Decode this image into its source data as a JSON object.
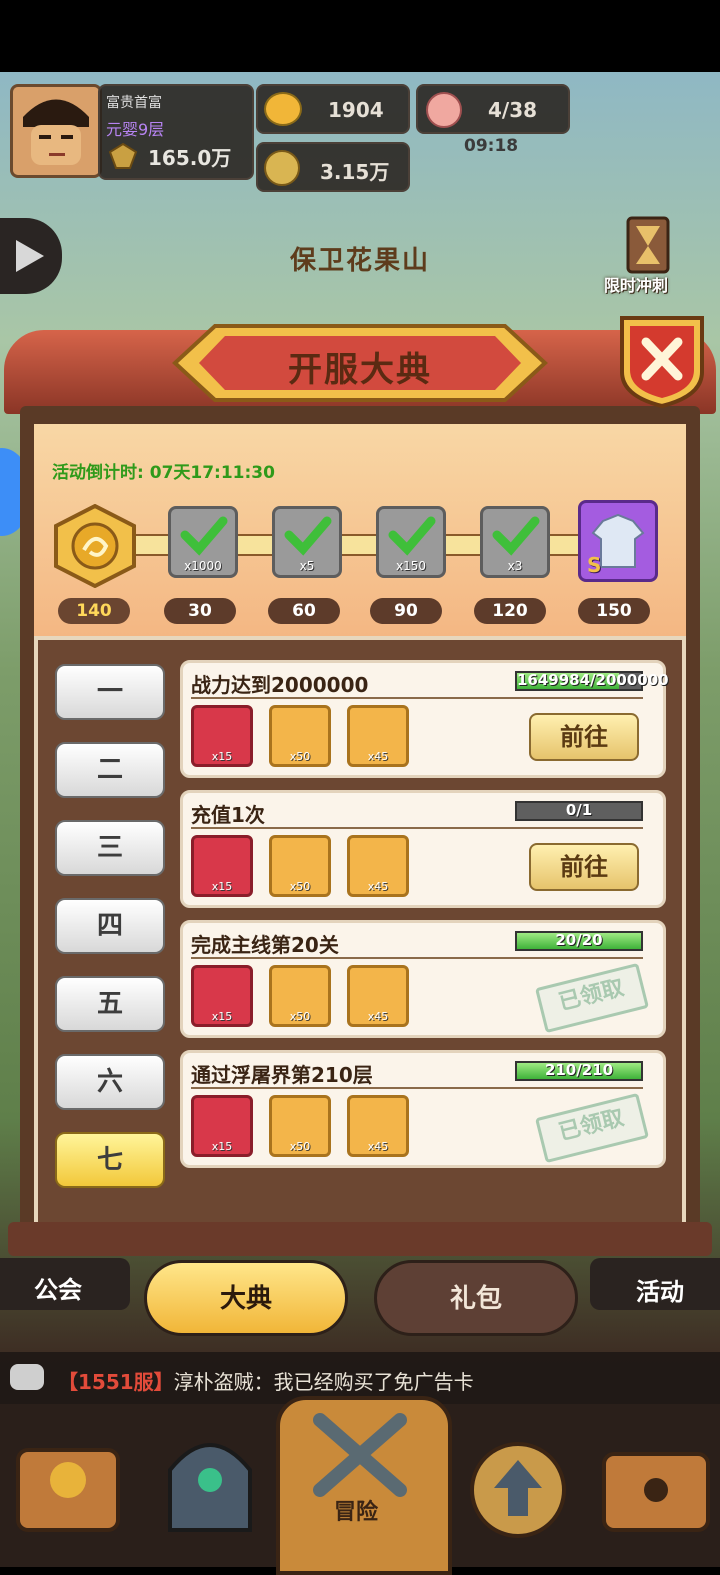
{
  "hud": {
    "player_title": "富贵首富",
    "player_rank": "元婴9层",
    "player_power": "165.0万",
    "ingots": "1904",
    "coins": "3.15万",
    "stamina": "4/38",
    "stamina_timer": "09:18"
  },
  "stage": {
    "title": "保卫花果山",
    "rush_label": "限时冲刺"
  },
  "panel": {
    "title": "开服大典",
    "countdown_label": "活动倒计时:",
    "countdown_value": "07天17:11:30",
    "current_points": "140",
    "milestones": [
      {
        "points": "30",
        "reward_count": "x1000",
        "claimed": true
      },
      {
        "points": "60",
        "reward_count": "x5",
        "claimed": true
      },
      {
        "points": "90",
        "reward_count": "x150",
        "claimed": true
      },
      {
        "points": "120",
        "reward_count": "x3",
        "claimed": true
      },
      {
        "points": "150",
        "reward_grade": "S",
        "claimed": false
      }
    ],
    "day_tabs": [
      "一",
      "二",
      "三",
      "四",
      "五",
      "六",
      "七"
    ],
    "active_tab": "七",
    "tasks": [
      {
        "title": "战力达到2000000",
        "progress": "1649984/2000000",
        "progress_fraction": 0.825,
        "rewards": [
          "x15",
          "x50",
          "x45"
        ],
        "action": "前往"
      },
      {
        "title": "充值1次",
        "progress": "0/1",
        "progress_fraction": 0,
        "rewards": [
          "x15",
          "x50",
          "x45"
        ],
        "action": "前往"
      },
      {
        "title": "完成主线第20关",
        "progress": "20/20",
        "progress_fraction": 1,
        "rewards": [
          "x15",
          "x50",
          "x45"
        ],
        "status": "已领取"
      },
      {
        "title": "通过浮屠界第210层",
        "progress": "210/210",
        "progress_fraction": 1,
        "rewards": [
          "x15",
          "x50",
          "x45"
        ],
        "status": "已领取"
      }
    ]
  },
  "bottom_tabs": {
    "active": "大典",
    "inactive": "礼包",
    "left_side": "公会",
    "right_side": "活动"
  },
  "chat": {
    "server": "【1551服】",
    "message": "淳朴盗贼：我已经购买了免广告卡"
  },
  "nav": {
    "center_label": "冒险"
  },
  "colors": {
    "accent_gold": "#f1b638",
    "panel_red": "#d8384a",
    "progress_green": "#3fb23a",
    "countdown_green": "#2f9a1a"
  }
}
